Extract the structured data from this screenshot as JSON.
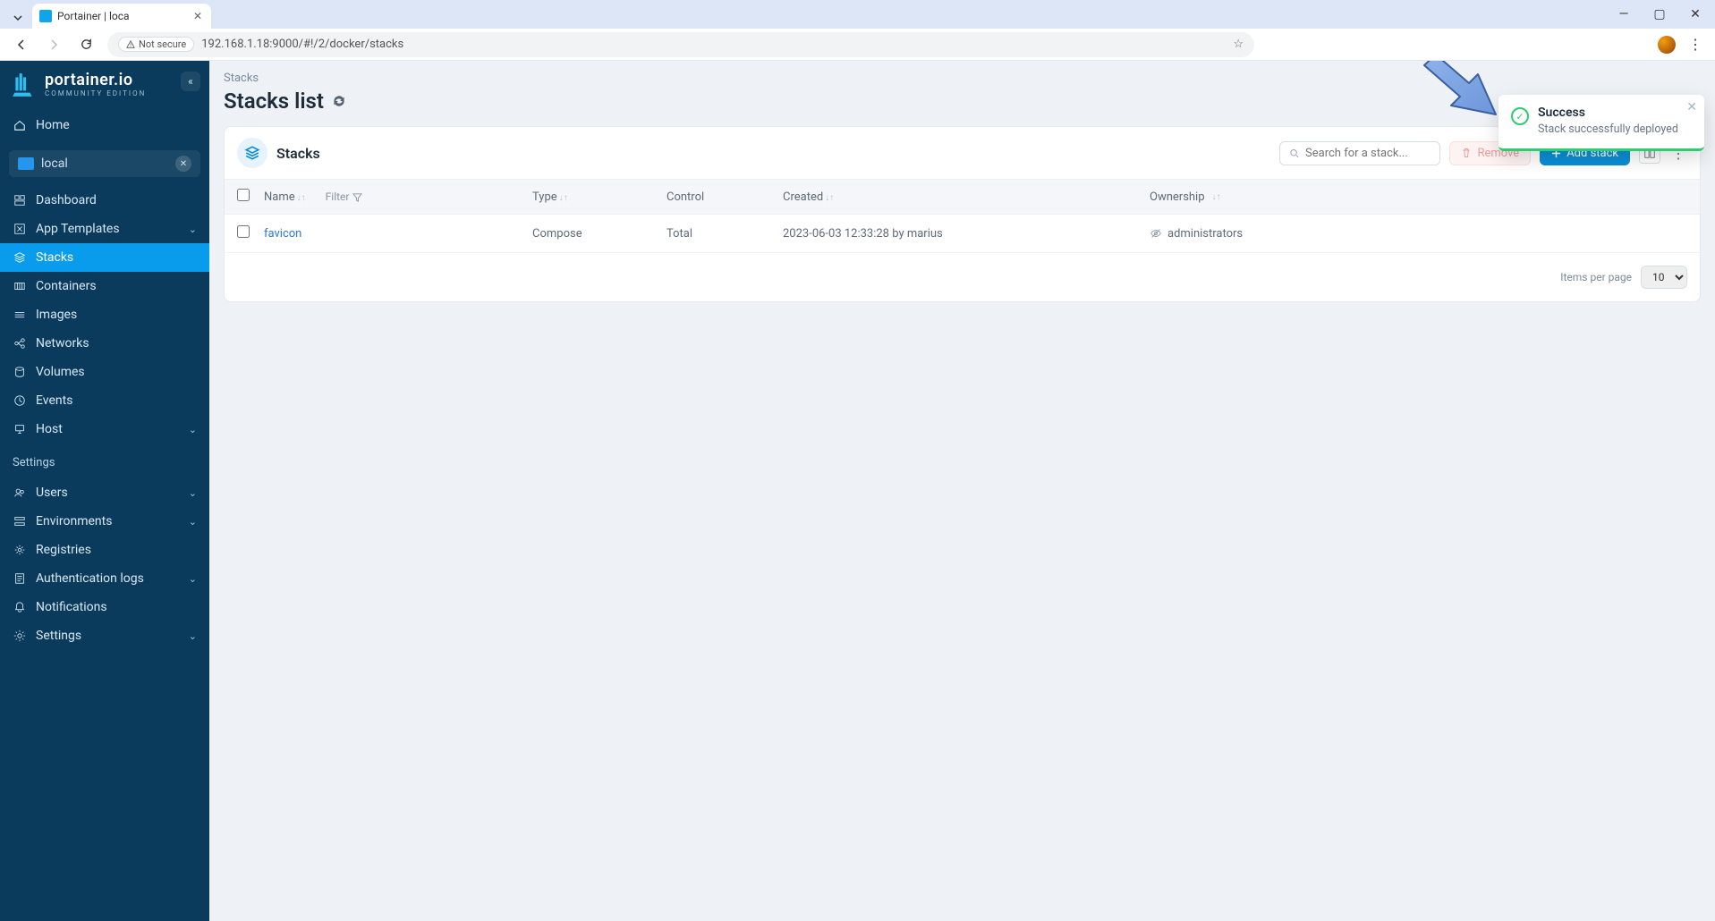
{
  "browser": {
    "tab_title": "Portainer | loca",
    "not_secure_label": "Not secure",
    "url": "192.168.1.18:9000/#!/2/docker/stacks"
  },
  "brand": {
    "name": "portainer.io",
    "edition": "COMMUNITY EDITION"
  },
  "sidebar": {
    "home": "Home",
    "env_name": "local",
    "items": {
      "dashboard": "Dashboard",
      "app_templates": "App Templates",
      "stacks": "Stacks",
      "containers": "Containers",
      "images": "Images",
      "networks": "Networks",
      "volumes": "Volumes",
      "events": "Events",
      "host": "Host"
    },
    "settings_label": "Settings",
    "settings": {
      "users": "Users",
      "environments": "Environments",
      "registries": "Registries",
      "auth_logs": "Authentication logs",
      "notifications": "Notifications",
      "settings": "Settings"
    }
  },
  "page": {
    "breadcrumb": "Stacks",
    "title": "Stacks list"
  },
  "panel": {
    "title": "Stacks",
    "search_placeholder": "Search for a stack...",
    "remove_label": "Remove",
    "add_label": "Add stack"
  },
  "table": {
    "headers": {
      "name": "Name",
      "filter": "Filter",
      "type": "Type",
      "control": "Control",
      "created": "Created",
      "ownership": "Ownership"
    },
    "rows": [
      {
        "name": "favicon",
        "type": "Compose",
        "control": "Total",
        "created": "2023-06-03 12:33:28 by marius",
        "ownership": "administrators"
      }
    ],
    "footer": {
      "label": "Items per page",
      "value": "10"
    }
  },
  "toast": {
    "title": "Success",
    "message": "Stack successfully deployed"
  }
}
